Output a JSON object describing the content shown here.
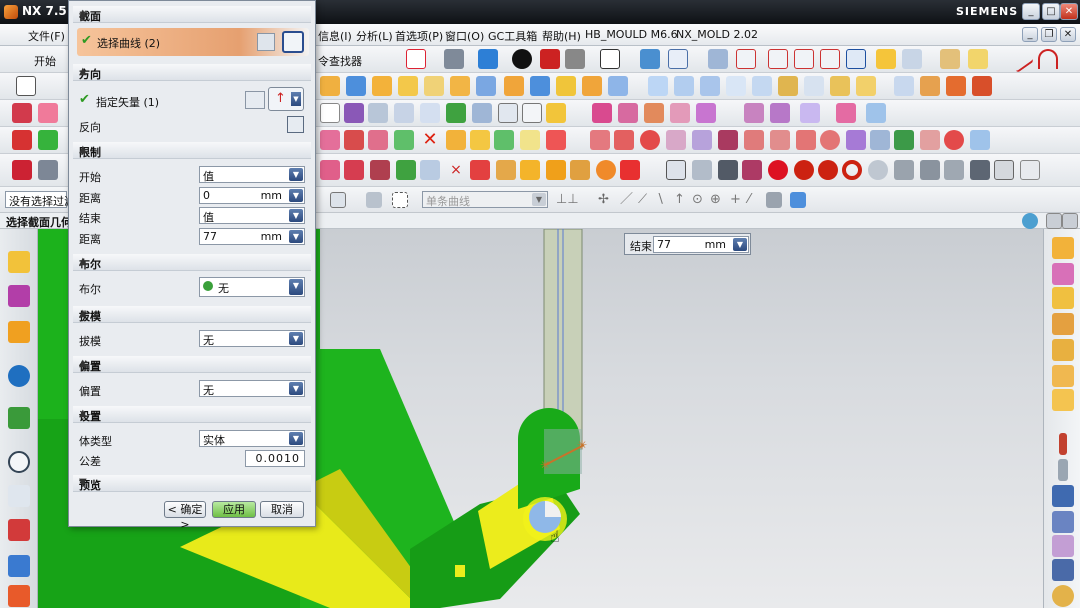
{
  "titlebar": {
    "title": "NX 7.5 - ",
    "brand": "SIEMENS"
  },
  "menubar": {
    "items": [
      "文件(F)",
      "信息(I)",
      "分析(L)",
      "首选项(P)",
      "窗口(O)",
      "GC工具箱",
      "帮助(H)",
      "HB_MOULD M6.6",
      "NX_MOLD 2.02"
    ],
    "start": "开始",
    "finder": "令查找器"
  },
  "selbar": {
    "filter_value": "没有选择过滤",
    "curve_rule": "单条曲线"
  },
  "statusbar": {
    "prompt": "选择截面几何"
  },
  "end_input": {
    "label": "结束",
    "value": "77",
    "unit": "mm"
  },
  "dialog": {
    "section_section": {
      "header": "截面",
      "select_curve": "选择曲线 (2)"
    },
    "direction": {
      "header": "方向",
      "specify_vector": "指定矢量 (1)",
      "reverse": "反向"
    },
    "limits": {
      "header": "限制",
      "start_label": "开始",
      "start_value": "值",
      "dist1_label": "距离",
      "dist1_value": "0",
      "dist1_unit": "mm",
      "end_label": "结束",
      "end_value": "值",
      "dist2_label": "距离",
      "dist2_value": "77",
      "dist2_unit": "mm"
    },
    "boolean": {
      "header": "布尔",
      "label": "布尔",
      "value": "无"
    },
    "draft": {
      "header": "拔模",
      "label": "拔模",
      "value": "无"
    },
    "offset": {
      "header": "偏置",
      "label": "偏置",
      "value": "无"
    },
    "settings": {
      "header": "设置",
      "body_label": "体类型",
      "body_value": "实体",
      "tol_label": "公差",
      "tol_value": "0.0010"
    },
    "preview": {
      "header": "预览"
    },
    "buttons": {
      "ok": "< 确定 >",
      "apply": "应用",
      "cancel": "取消"
    }
  },
  "colors": {
    "part_green": "#1fb51f",
    "part_yellow": "#f2f21a",
    "accent_orange": "#f0b27a"
  }
}
